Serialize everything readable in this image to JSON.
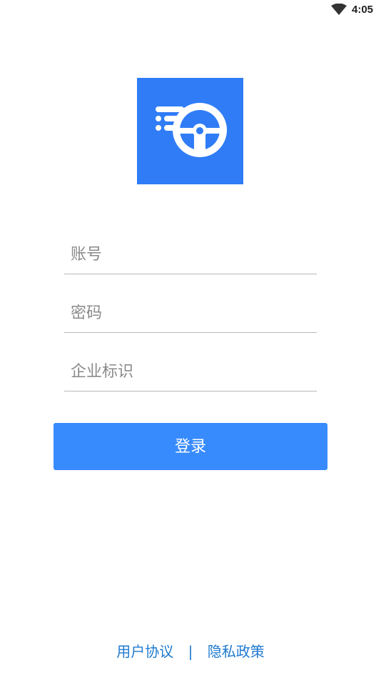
{
  "status_bar": {
    "time": "4:05",
    "wifi_icon": "wifi-icon"
  },
  "logo": {
    "icon": "steering-wheel-icon",
    "color": "#2f7cf6"
  },
  "form": {
    "account_placeholder": "账号",
    "password_placeholder": "密码",
    "enterprise_placeholder": "企业标识",
    "login_label": "登录",
    "button_color": "#388bfd"
  },
  "footer": {
    "user_agreement": "用户协议",
    "separator": "|",
    "privacy_policy": "隐私政策",
    "link_color": "#1f7ad1"
  }
}
